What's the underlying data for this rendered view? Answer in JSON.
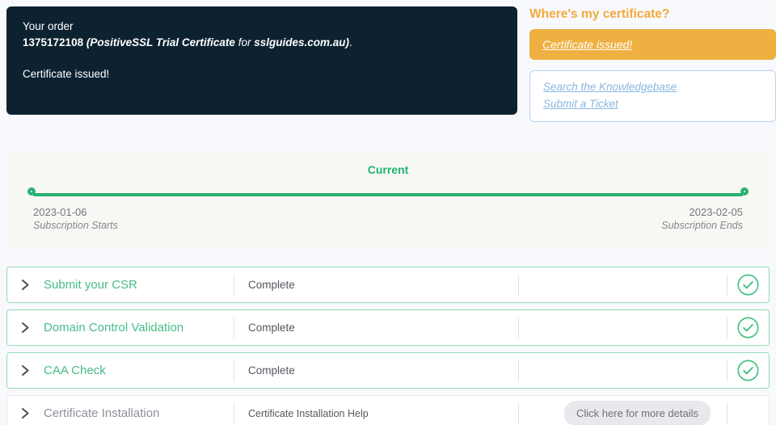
{
  "order_box": {
    "label": "Your order",
    "number": "1375172108",
    "cert_name": "(PositiveSSL Trial Certificate",
    "connector": "for",
    "domain": "sslguides.com.au)",
    "period": ".",
    "status": "Certificate issued!"
  },
  "help_panel": {
    "heading": "Where's my certificate?",
    "issued_button": "Certificate issued!",
    "link_knowledgebase": "Search the Knowledgebase",
    "link_ticket": "Submit a Ticket"
  },
  "timeline": {
    "current_label": "Current",
    "start_date": "2023-01-06",
    "start_label": "Subscription Starts",
    "end_date": "2023-02-05",
    "end_label": "Subscription Ends"
  },
  "steps": [
    {
      "title": "Submit your CSR",
      "status": "Complete",
      "complete": true
    },
    {
      "title": "Domain Control Validation",
      "status": "Complete",
      "complete": true
    },
    {
      "title": "CAA Check",
      "status": "Complete",
      "complete": true
    },
    {
      "title": "Certificate Installation",
      "status": "Certificate Installation Help",
      "complete": false,
      "action": "Click here for more details"
    }
  ],
  "colors": {
    "navy": "#0d2231",
    "amber_button": "#efb042",
    "orange_heading": "#f4a93c",
    "link_blue": "#8bb7e2",
    "green": "#27b170",
    "title_green": "#47bc87"
  }
}
